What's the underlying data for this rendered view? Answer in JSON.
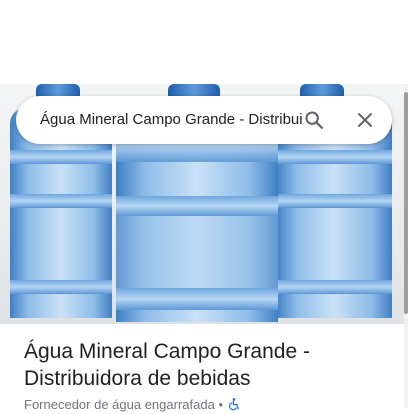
{
  "search": {
    "query": "Água Mineral Campo Grande - Distribuidora de bebidas"
  },
  "place": {
    "title": "Água Mineral Campo Grande - Distribuidora de bebidas",
    "category": "Fornecedor de água engarrafada",
    "separator": "•"
  },
  "icons": {
    "search": "search-icon",
    "clear": "close-icon",
    "accessibility": "wheelchair-icon"
  },
  "colors": {
    "text": "#202124",
    "secondary_text": "#70757a",
    "icon": "#5f6368",
    "accessibility": "#1a73e8"
  }
}
